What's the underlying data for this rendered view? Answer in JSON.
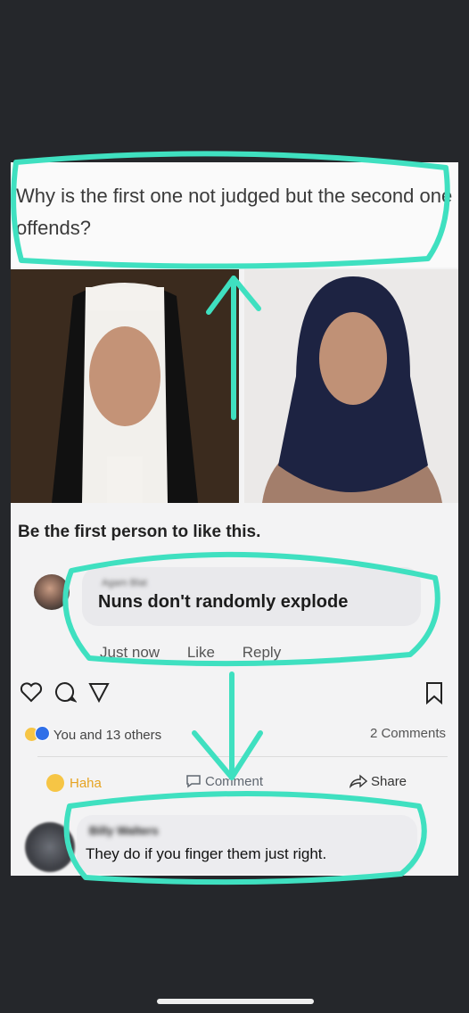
{
  "post": {
    "question": "Why is the first one not judged but the second one offends?"
  },
  "likes_prompt": "Be the first person to like this.",
  "comment1": {
    "author": "Agam Blat",
    "text": "Nuns don't randomly explode",
    "time": "Just now",
    "like_label": "Like",
    "reply_label": "Reply"
  },
  "icons": [
    "heart-icon",
    "comment-icon",
    "send-icon",
    "bookmark-icon"
  ],
  "reactions": {
    "summary": "You and 13 others",
    "comments_count": "2 Comments"
  },
  "fb_actions": {
    "haha": "Haha",
    "comment": "Comment",
    "share": "Share"
  },
  "comment2": {
    "author": "Billy Walters",
    "text": "They do if you finger them just right."
  },
  "colors": {
    "annotation": "#3fe0c0",
    "background": "#25272b",
    "screen": "#f3f3f4"
  }
}
